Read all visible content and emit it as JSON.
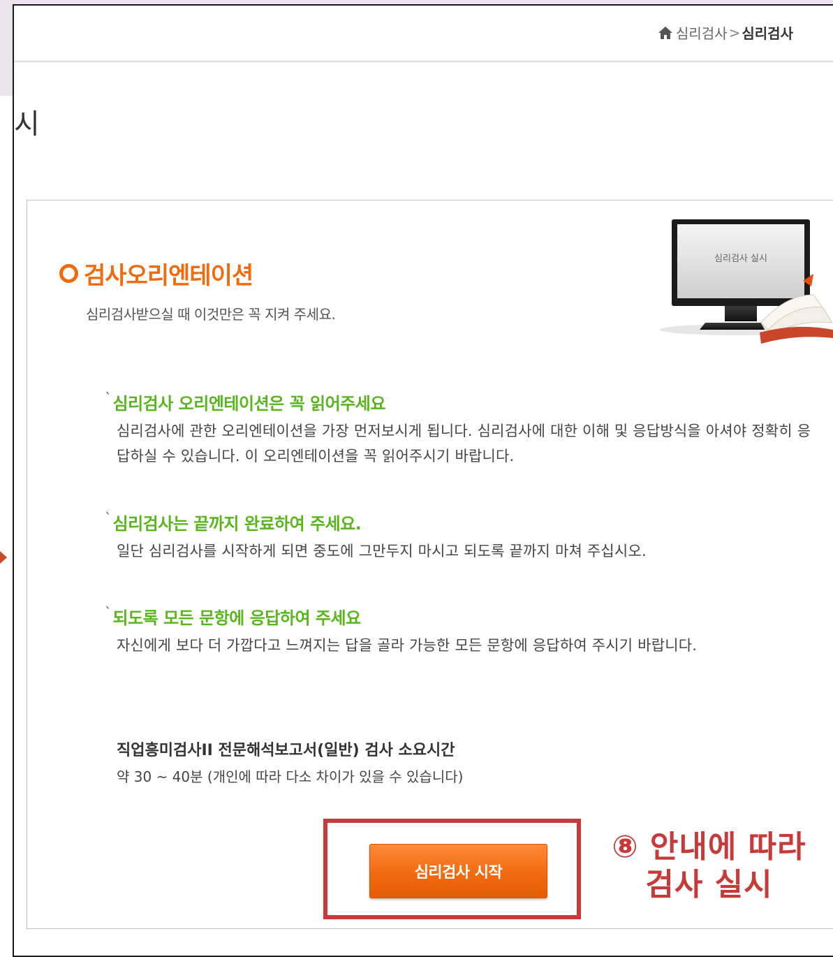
{
  "breadcrumb": {
    "items": [
      "심리검사",
      "심리검사"
    ],
    "separator": ">"
  },
  "page_title_fragment": "시",
  "section": {
    "heading": "검사오리엔테이션",
    "subtitle": "심리검사받으실 때 이것만은 꼭 지켜 주세요."
  },
  "illustration": {
    "screen_text": "심리검사 실시"
  },
  "guides": [
    {
      "title": "심리검사 오리엔테이션은 꼭 읽어주세요",
      "body": "심리검사에 관한 오리엔테이션을 가장 먼저보시게 됩니다. 심리검사에 대한 이해 및 응답방식을 아셔야 정확히 응답하실 수 있습니다. 이 오리엔테이션을 꼭 읽어주시기 바랍니다."
    },
    {
      "title": "심리검사는 끝까지 완료하여 주세요.",
      "body": "일단 심리검사를 시작하게 되면 중도에 그만두지 마시고 되도록 끝까지 마쳐 주십시오."
    },
    {
      "title": "되도록 모든 문항에 응답하여 주세요",
      "body": "자신에게 보다 더 가깝다고 느껴지는 답을 골라 가능한 모든 문항에 응답하여 주시기 바랍니다."
    }
  ],
  "duration": {
    "title": "직업흥미검사II 전문해석보고서(일반) 검사 소요시간",
    "body": "약 30 ~ 40분 (개인에 따라 다소 차이가 있을 수 있습니다)"
  },
  "start_button": {
    "label": "심리검사 시작"
  },
  "annotation": {
    "line1": "⑧ 안내에 따라",
    "line2": "검사 실시"
  },
  "colors": {
    "accent_orange": "#f06a0e",
    "guide_green": "#58b51c",
    "annotation_red": "#c83a3a",
    "background_lavender": "#ece3ef"
  },
  "icons": [
    "home-icon",
    "ring-bullet-icon",
    "left-arrow-icon"
  ]
}
